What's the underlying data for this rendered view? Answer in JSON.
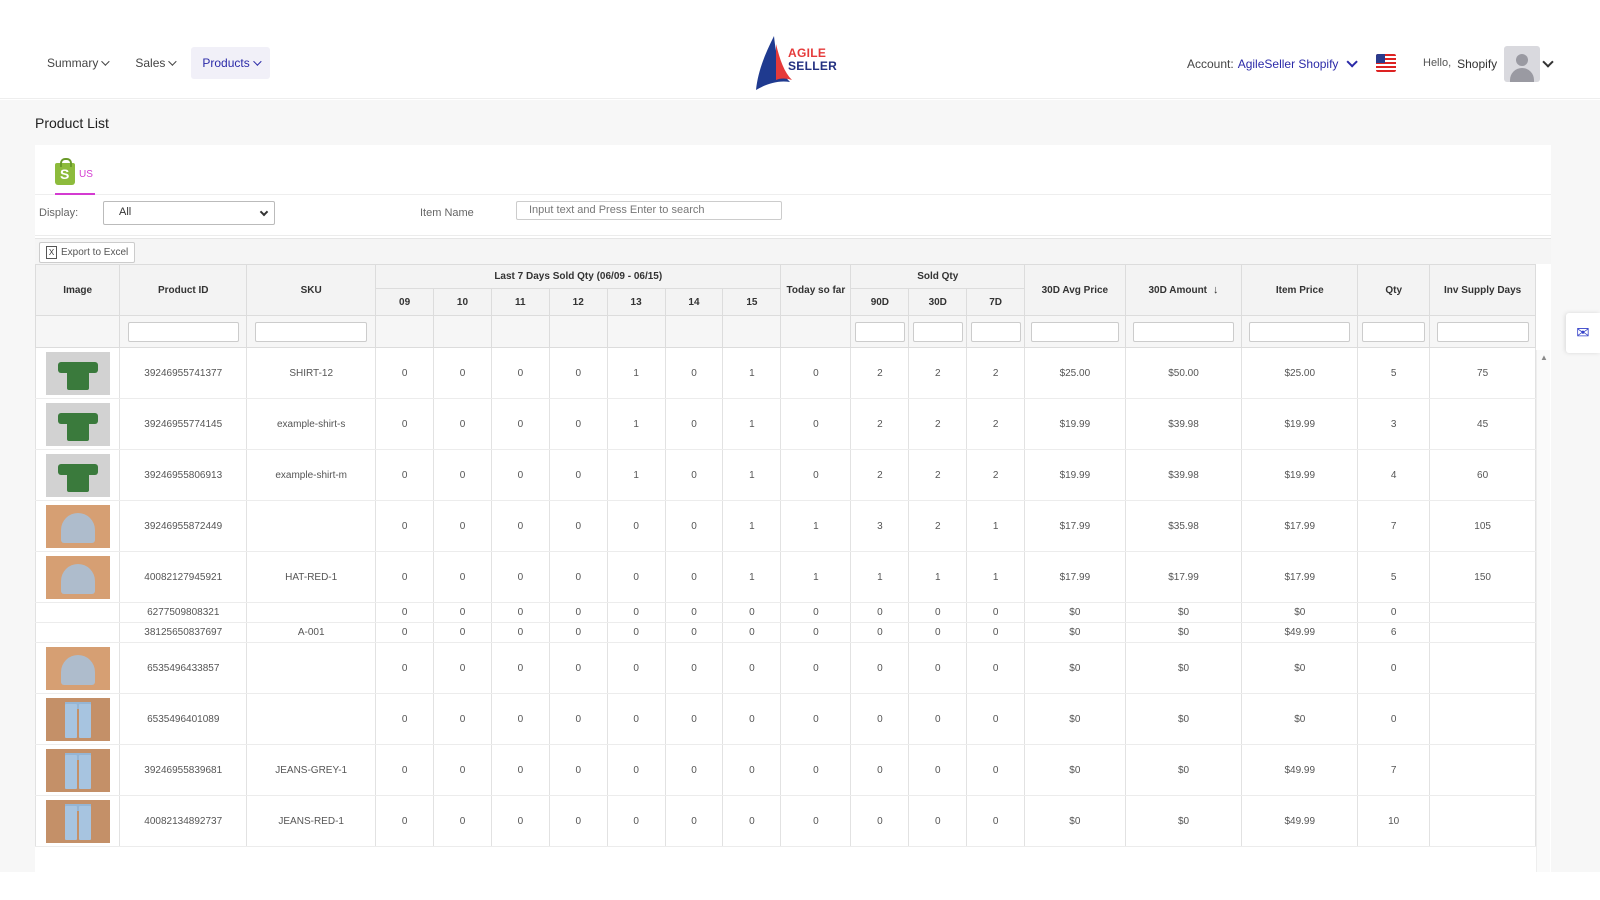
{
  "nav": {
    "items": [
      {
        "label": "Summary",
        "active": false
      },
      {
        "label": "Sales",
        "active": false
      },
      {
        "label": "Products",
        "active": true
      }
    ]
  },
  "logo": {
    "line1": "AGILE",
    "line2": "SELLER"
  },
  "account": {
    "prefix": "Account:",
    "name": "AgileSeller Shopify"
  },
  "greeting": {
    "hello": "Hello,",
    "user": "Shopify"
  },
  "page": {
    "title": "Product List"
  },
  "tabs": {
    "us_label": "US"
  },
  "filters": {
    "display_label": "Display:",
    "display_value": "All",
    "item_name_label": "Item Name",
    "search_placeholder": "Input text and Press Enter to search"
  },
  "toolbar": {
    "export_label": "Export to Excel"
  },
  "table": {
    "group_headers": {
      "last7": "Last 7 Days Sold Qty (06/09 - 06/15)",
      "today": "Today so far",
      "sold_qty": "Sold Qty"
    },
    "headers": {
      "image": "Image",
      "product_id": "Product ID",
      "sku": "SKU",
      "days": [
        "09",
        "10",
        "11",
        "12",
        "13",
        "14",
        "15"
      ],
      "d90": "90D",
      "d30": "30D",
      "d7": "7D",
      "avg_price": "30D Avg Price",
      "amount": "30D Amount",
      "item_price": "Item Price",
      "qty": "Qty",
      "inv_supply": "Inv Supply Days"
    },
    "sort_indicator": "↓",
    "rows": [
      {
        "img": "shirt",
        "pid": "39246955741377",
        "sku": "SHIRT-12",
        "d": [
          "0",
          "0",
          "0",
          "0",
          "1",
          "0",
          "1"
        ],
        "today": "0",
        "s90": "2",
        "s30": "2",
        "s7": "2",
        "avg": "$25.00",
        "amt": "$50.00",
        "price": "$25.00",
        "qty": "5",
        "inv": "75",
        "size": "tall"
      },
      {
        "img": "shirt",
        "pid": "39246955774145",
        "sku": "example-shirt-s",
        "d": [
          "0",
          "0",
          "0",
          "0",
          "1",
          "0",
          "1"
        ],
        "today": "0",
        "s90": "2",
        "s30": "2",
        "s7": "2",
        "avg": "$19.99",
        "amt": "$39.98",
        "price": "$19.99",
        "qty": "3",
        "inv": "45",
        "size": "tall"
      },
      {
        "img": "shirt",
        "pid": "39246955806913",
        "sku": "example-shirt-m",
        "d": [
          "0",
          "0",
          "0",
          "0",
          "1",
          "0",
          "1"
        ],
        "today": "0",
        "s90": "2",
        "s30": "2",
        "s7": "2",
        "avg": "$19.99",
        "amt": "$39.98",
        "price": "$19.99",
        "qty": "4",
        "inv": "60",
        "size": "tall"
      },
      {
        "img": "beanie",
        "pid": "39246955872449",
        "sku": "",
        "d": [
          "0",
          "0",
          "0",
          "0",
          "0",
          "0",
          "1"
        ],
        "today": "1",
        "s90": "3",
        "s30": "2",
        "s7": "1",
        "avg": "$17.99",
        "amt": "$35.98",
        "price": "$17.99",
        "qty": "7",
        "inv": "105",
        "size": "tall"
      },
      {
        "img": "beanie",
        "pid": "40082127945921",
        "sku": "HAT-RED-1",
        "d": [
          "0",
          "0",
          "0",
          "0",
          "0",
          "0",
          "1"
        ],
        "today": "1",
        "s90": "1",
        "s30": "1",
        "s7": "1",
        "avg": "$17.99",
        "amt": "$17.99",
        "price": "$17.99",
        "qty": "5",
        "inv": "150",
        "size": "tall"
      },
      {
        "img": "",
        "pid": "6277509808321",
        "sku": "",
        "d": [
          "0",
          "0",
          "0",
          "0",
          "0",
          "0",
          "0"
        ],
        "today": "0",
        "s90": "0",
        "s30": "0",
        "s7": "0",
        "avg": "$0",
        "amt": "$0",
        "price": "$0",
        "qty": "0",
        "inv": "",
        "size": "short"
      },
      {
        "img": "",
        "pid": "38125650837697",
        "sku": "A-001",
        "d": [
          "0",
          "0",
          "0",
          "0",
          "0",
          "0",
          "0"
        ],
        "today": "0",
        "s90": "0",
        "s30": "0",
        "s7": "0",
        "avg": "$0",
        "amt": "$0",
        "price": "$49.99",
        "qty": "6",
        "inv": "",
        "size": "short"
      },
      {
        "img": "beanie",
        "pid": "6535496433857",
        "sku": "",
        "d": [
          "0",
          "0",
          "0",
          "0",
          "0",
          "0",
          "0"
        ],
        "today": "0",
        "s90": "0",
        "s30": "0",
        "s7": "0",
        "avg": "$0",
        "amt": "$0",
        "price": "$0",
        "qty": "0",
        "inv": "",
        "size": "tall"
      },
      {
        "img": "jeans",
        "pid": "6535496401089",
        "sku": "",
        "d": [
          "0",
          "0",
          "0",
          "0",
          "0",
          "0",
          "0"
        ],
        "today": "0",
        "s90": "0",
        "s30": "0",
        "s7": "0",
        "avg": "$0",
        "amt": "$0",
        "price": "$0",
        "qty": "0",
        "inv": "",
        "size": "tall"
      },
      {
        "img": "jeans",
        "pid": "39246955839681",
        "sku": "JEANS-GREY-1",
        "d": [
          "0",
          "0",
          "0",
          "0",
          "0",
          "0",
          "0"
        ],
        "today": "0",
        "s90": "0",
        "s30": "0",
        "s7": "0",
        "avg": "$0",
        "amt": "$0",
        "price": "$49.99",
        "qty": "7",
        "inv": "",
        "size": "tall"
      },
      {
        "img": "jeans",
        "pid": "40082134892737",
        "sku": "JEANS-RED-1",
        "d": [
          "0",
          "0",
          "0",
          "0",
          "0",
          "0",
          "0"
        ],
        "today": "0",
        "s90": "0",
        "s30": "0",
        "s7": "0",
        "avg": "$0",
        "amt": "$0",
        "price": "$49.99",
        "qty": "10",
        "inv": "",
        "size": "tall"
      }
    ]
  },
  "colors": {
    "accent": "#2b2aa8",
    "tab_accent": "#d43bd1",
    "shopify_green": "#8dbb3c"
  },
  "icons": {
    "export": "excel-icon",
    "mail": "mail-icon",
    "flag": "us-flag-icon"
  }
}
